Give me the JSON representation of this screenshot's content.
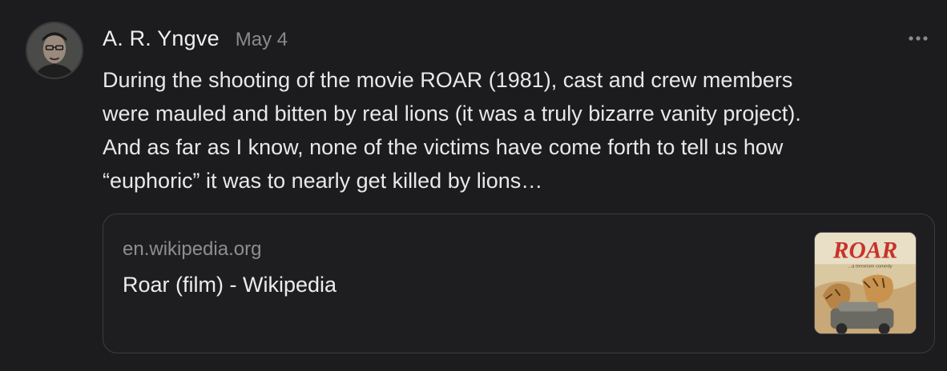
{
  "post": {
    "author": "A. R. Yngve",
    "date": "May 4",
    "text_lines": [
      "During the shooting of the movie ROAR (1981), cast and crew members",
      "were mauled and bitten by real lions (it was a truly bizarre vanity project).",
      "And as far as I know, none of the victims have come forth to tell us how",
      "“euphoric” it was to nearly get killed by lions…"
    ],
    "more_icon": "ellipsis-icon",
    "avatar_icon": "user-avatar"
  },
  "link_card": {
    "domain": "en.wikipedia.org",
    "title": "Roar (film) - Wikipedia",
    "thumbnail": {
      "poster_title": "ROAR",
      "poster_tagline": "...a terrorism comedy"
    }
  },
  "colors": {
    "background": "#1c1c1e",
    "card_border": "#3c3c3f",
    "muted_text": "#8a8a8e",
    "poster_red": "#c8322a"
  }
}
